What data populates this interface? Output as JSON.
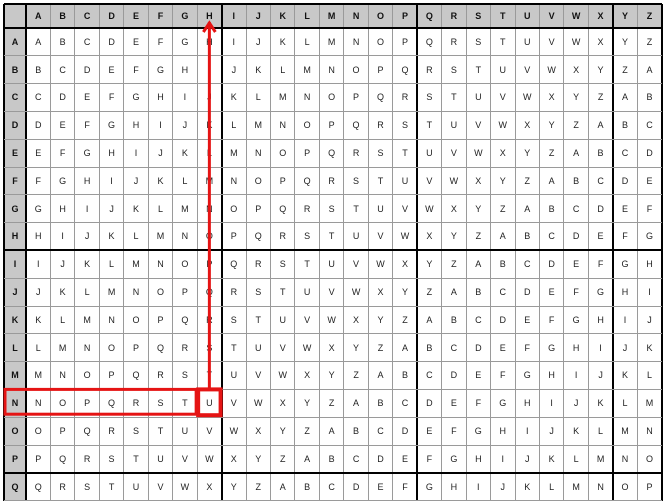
{
  "alphabet": [
    "A",
    "B",
    "C",
    "D",
    "E",
    "F",
    "G",
    "H",
    "I",
    "J",
    "K",
    "L",
    "M",
    "N",
    "O",
    "P",
    "Q",
    "R",
    "S",
    "T",
    "U",
    "V",
    "W",
    "X",
    "Y",
    "Z"
  ],
  "visible_row_count": 17,
  "highlight": {
    "column_letter": "H",
    "row_letter": "N",
    "result_letter": "U",
    "color": "#e51414"
  },
  "colors": {
    "header_bg": "#c8c8c8",
    "grid_line": "#000000",
    "thin_line": "#9a9a9a"
  }
}
